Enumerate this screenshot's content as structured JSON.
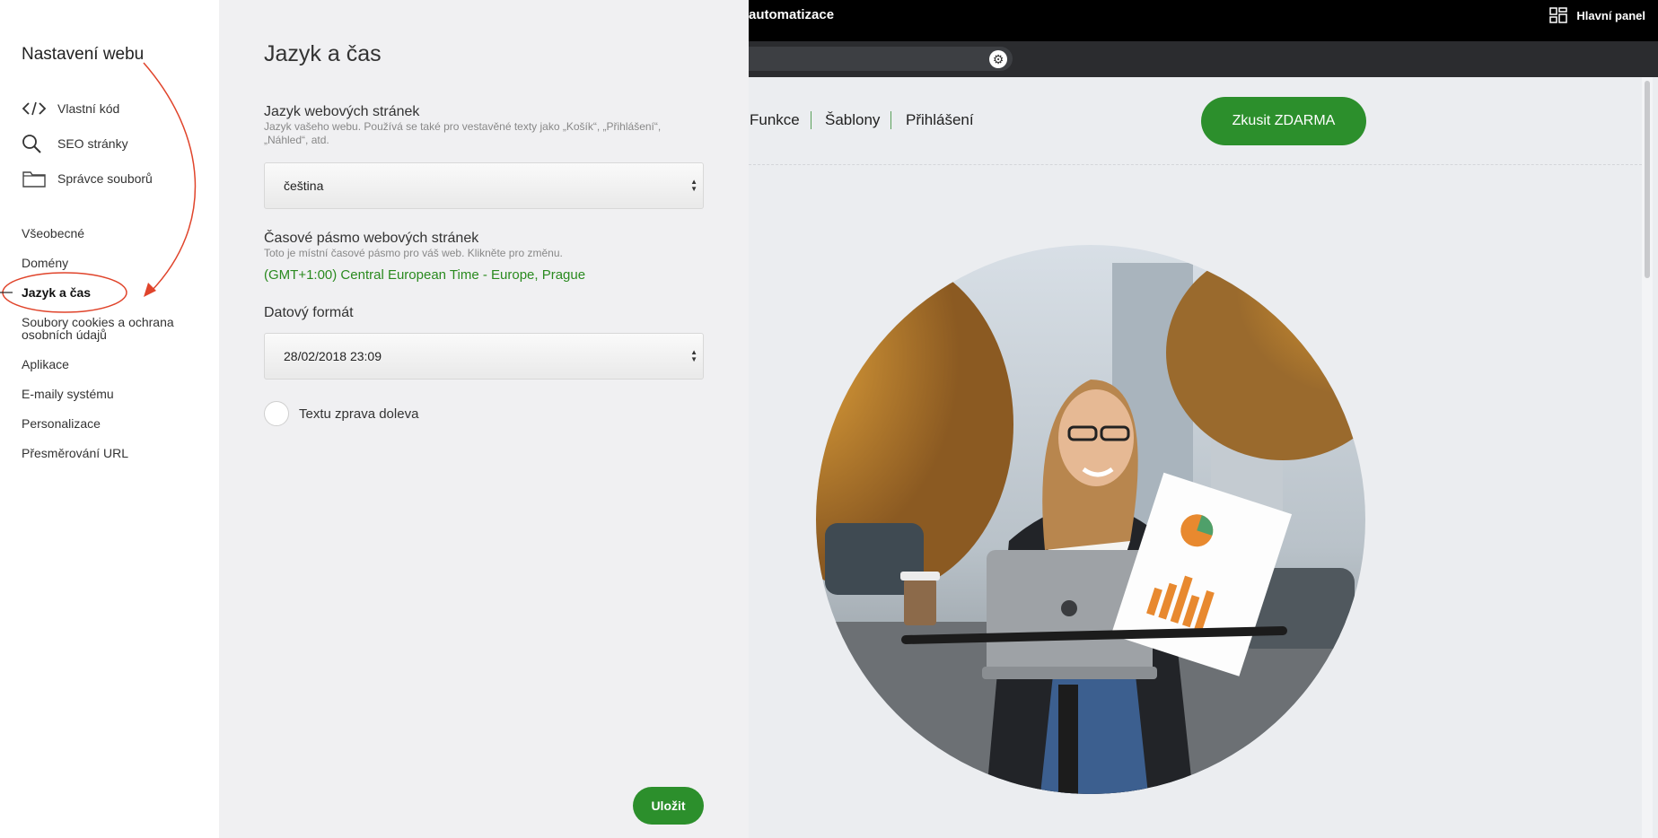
{
  "sidebar": {
    "title": "Nastavení webu",
    "tools": [
      {
        "label": "Vlastní kód",
        "icon": "code-icon"
      },
      {
        "label": "SEO stránky",
        "icon": "search-icon"
      },
      {
        "label": "Správce souborů",
        "icon": "folder-icon"
      }
    ],
    "nav": [
      {
        "label": "Všeobecné",
        "active": false
      },
      {
        "label": "Domény",
        "active": false
      },
      {
        "label": "Jazyk a čas",
        "active": true
      },
      {
        "label": "Soubory cookies a ochrana osobních údajů",
        "active": false
      },
      {
        "label": "Aplikace",
        "active": false
      },
      {
        "label": "E-maily systému",
        "active": false
      },
      {
        "label": "Personalizace",
        "active": false
      },
      {
        "label": "Přesměrování URL",
        "active": false
      }
    ],
    "annotation_color": "#e0442b"
  },
  "panel": {
    "title": "Jazyk a čas",
    "language": {
      "title": "Jazyk webových stránek",
      "description": "Jazyk vašeho webu. Používá se také pro vestavěné texty jako „Košík“, „Přihlášení“, „Náhled“, atd.",
      "value": "čeština"
    },
    "timezone": {
      "title": "Časové pásmo webových stránek",
      "description": "Toto je místní časové pásmo pro váš web. Klikněte pro změnu.",
      "value": "(GMT+1:00) Central European Time - Europe, Prague"
    },
    "date_format": {
      "title": "Datový formát",
      "value": "28/02/2018 23:09"
    },
    "rtl_toggle": {
      "label": "Textu zprava doleva",
      "checked": false
    },
    "save_label": "Uložit"
  },
  "preview": {
    "topbar": {
      "brand": "automatizace",
      "dashboard_label": "Hlavní panel"
    },
    "menu": [
      "Funkce",
      "Šablony",
      "Přihlášení"
    ],
    "cta_label": "Zkusit ZDARMA",
    "accent_color": "#2c8f2c"
  }
}
